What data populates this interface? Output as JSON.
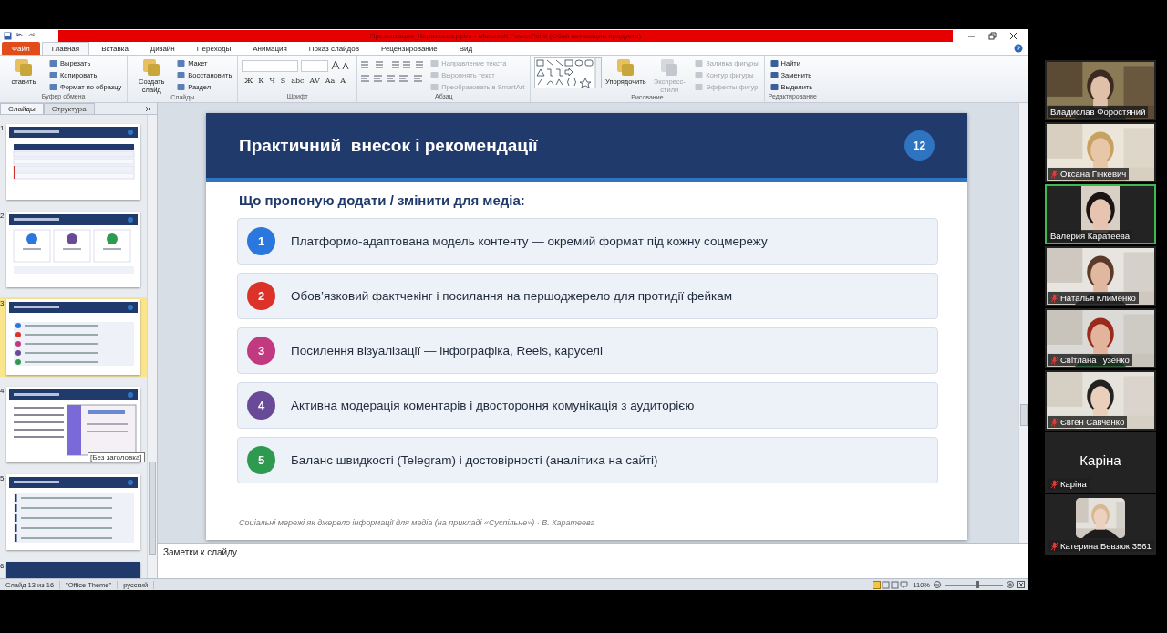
{
  "window": {
    "title": "Презентация_Каратеева.pptm  -  Microsoft PowerPoint (Сбой активации продукта)"
  },
  "ribbon_tabs": [
    {
      "label": "Файл",
      "kind": "file",
      "selected": false
    },
    {
      "label": "Главная",
      "kind": "tab",
      "selected": true
    },
    {
      "label": "Вставка",
      "kind": "tab",
      "selected": false
    },
    {
      "label": "Дизайн",
      "kind": "tab",
      "selected": false
    },
    {
      "label": "Переходы",
      "kind": "tab",
      "selected": false
    },
    {
      "label": "Анимация",
      "kind": "tab",
      "selected": false
    },
    {
      "label": "Показ слайдов",
      "kind": "tab",
      "selected": false
    },
    {
      "label": "Рецензирование",
      "kind": "tab",
      "selected": false
    },
    {
      "label": "Вид",
      "kind": "tab",
      "selected": false
    }
  ],
  "ribbon": {
    "groups": [
      {
        "kind": "clipboard",
        "label": "Буфер обмена",
        "big": [
          {
            "label": "ставить",
            "disabled": false
          }
        ],
        "items": [
          {
            "label": "Вырезать",
            "disabled": false
          },
          {
            "label": "Копировать",
            "disabled": false
          },
          {
            "label": "Формат по образцу",
            "disabled": false
          }
        ]
      },
      {
        "kind": "slides",
        "label": "Слайды",
        "big": [
          {
            "label": "Создать слайд",
            "disabled": false
          }
        ],
        "items": [
          {
            "label": "Макет",
            "disabled": false
          },
          {
            "label": "Восстановить",
            "disabled": false
          },
          {
            "label": "Раздел",
            "disabled": false
          }
        ]
      },
      {
        "kind": "font",
        "label": "Шрифт",
        "glyphs": [
          "Ж",
          "К",
          "Ч",
          "S",
          "abc",
          "AV",
          "Aa",
          "A"
        ]
      },
      {
        "kind": "paragraph",
        "label": "Абзац",
        "items": [
          {
            "label": "Направление текста",
            "disabled": true
          },
          {
            "label": "Выровнять текст",
            "disabled": true
          },
          {
            "label": "Преобразовать в SmartArt",
            "disabled": true
          }
        ]
      },
      {
        "kind": "drawing",
        "label": "Рисование",
        "big": [
          {
            "label": "Упорядочить",
            "disabled": false
          },
          {
            "label": "Экспресс-стили",
            "disabled": true
          }
        ],
        "items": [
          {
            "label": "Заливка фигуры",
            "disabled": true
          },
          {
            "label": "Контур фигуры",
            "disabled": true
          },
          {
            "label": "Эффекты фигур",
            "disabled": true
          }
        ]
      },
      {
        "kind": "editing",
        "label": "Редактирование",
        "items": [
          {
            "label": "Найти",
            "disabled": false
          },
          {
            "label": "Заменить",
            "disabled": false
          },
          {
            "label": "Выделить",
            "disabled": false
          }
        ]
      }
    ]
  },
  "pane_tabs": [
    {
      "label": "Слайды",
      "selected": true
    },
    {
      "label": "Структура",
      "selected": false
    }
  ],
  "thumbnails": [
    {
      "number": "1",
      "kind": "table",
      "selected": false
    },
    {
      "number": "2",
      "kind": "cards",
      "selected": false
    },
    {
      "number": "3",
      "kind": "list",
      "selected": true
    },
    {
      "number": "4",
      "kind": "certificate",
      "selected": false,
      "tooltip": "[Без заголовка]"
    },
    {
      "number": "5",
      "kind": "bullets",
      "selected": false
    },
    {
      "number": "6",
      "kind": "blank",
      "selected": false
    }
  ],
  "slide": {
    "title": "Практичний  внесок і рекомендації",
    "number": "12",
    "subtitle": "Що пропоную додати / змінити для медіа:",
    "items": [
      {
        "number": "1",
        "color": "#2a78de",
        "text": "Платформо-адаптована модель контенту — окремий формат під кожну соцмережу"
      },
      {
        "number": "2",
        "color": "#dc3228",
        "text": "Обов’язковий фактчекінг і посилання на першоджерело для протидії фейкам"
      },
      {
        "number": "3",
        "color": "#c13a80",
        "text": "Посилення візуалізації — інфографіка, Reels, каруселі"
      },
      {
        "number": "4",
        "color": "#684a98",
        "text": "Активна модерація коментарів і двостороння комунікація з аудиторією"
      },
      {
        "number": "5",
        "color": "#2e9a50",
        "text": "Баланс швидкості (Telegram) і достовірності (аналітика на сайті)"
      }
    ],
    "footer": "Соціальні мережі як джерело інформації для медіа (на прикладі «Суспільне») · В. Каратеева"
  },
  "notes": "Заметки к слайду",
  "status_bar": {
    "slide": "Слайд 13 из 16",
    "theme": "\"Office Theme\"",
    "language": "русский",
    "zoom": "110%",
    "level": 0.55
  },
  "participants": [
    {
      "name": "Владислав Форостяний",
      "kind": "video",
      "muted": false,
      "selected": false
    },
    {
      "name": "Оксана Гінкевич",
      "kind": "video",
      "muted": true,
      "selected": false
    },
    {
      "name": "Валерия Каратеева",
      "kind": "portrait",
      "muted": false,
      "selected": true
    },
    {
      "name": "Наталья Клименко",
      "kind": "video",
      "muted": true,
      "selected": false
    },
    {
      "name": "Світлана Гузенко",
      "kind": "video",
      "muted": true,
      "selected": false
    },
    {
      "name": "Євген Савченко",
      "kind": "video",
      "muted": true,
      "selected": false
    },
    {
      "name": "Каріна",
      "display_name": "Каріна",
      "kind": "name",
      "muted": true,
      "selected": false
    },
    {
      "name": "Катерина Бевзюк 3561",
      "muted": true,
      "selected": false
    }
  ]
}
